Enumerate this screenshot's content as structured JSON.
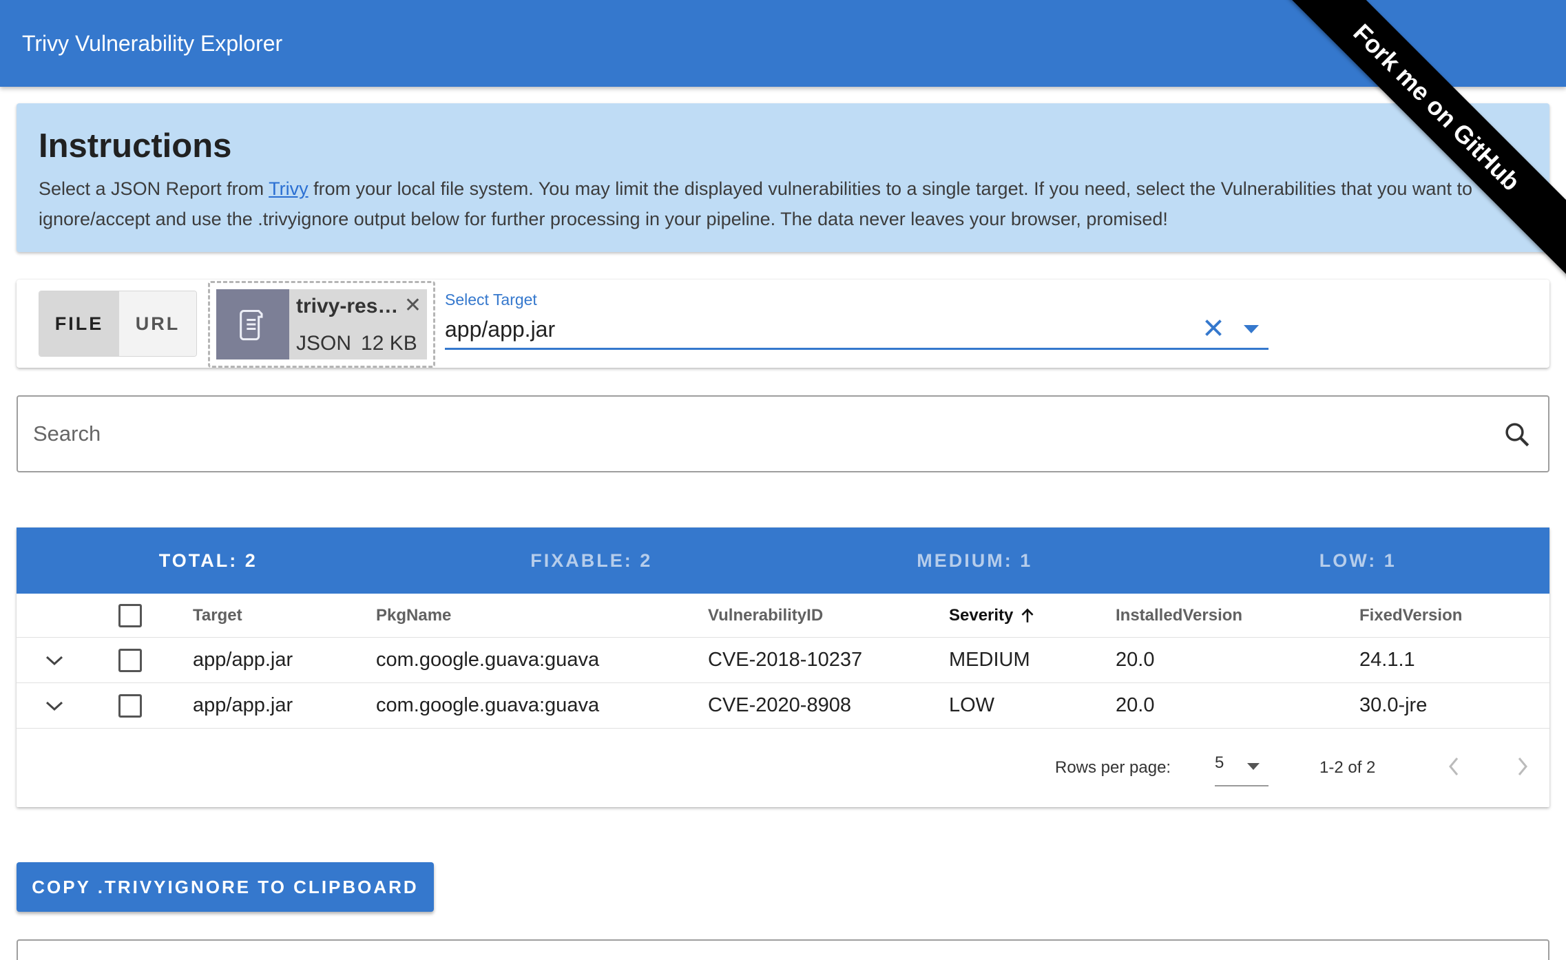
{
  "app": {
    "title": "Trivy Vulnerability Explorer"
  },
  "ribbon": {
    "label": "Fork me on GitHub"
  },
  "instructions": {
    "title": "Instructions",
    "text_before": "Select a JSON Report from ",
    "link": "Trivy",
    "text_after": " from your local file system. You may limit the displayed vulnerabilities to a single target. If you need, select the Vulnerabilities that you want to ignore/accept and use the .trivyignore output below for further processing in your pipeline. The data never leaves your browser, promised!"
  },
  "source_toggle": {
    "file": "FILE",
    "url": "URL",
    "selected": "FILE"
  },
  "file": {
    "name": "trivy-res…",
    "type": "JSON",
    "size": "12 KB"
  },
  "select_target": {
    "label": "Select Target",
    "value": "app/app.jar"
  },
  "search": {
    "placeholder": "Search",
    "value": ""
  },
  "stats": {
    "total": "TOTAL: 2",
    "fixable": "FIXABLE: 2",
    "medium": "MEDIUM: 1",
    "low": "LOW: 1"
  },
  "table": {
    "headers": {
      "target": "Target",
      "pkgname": "PkgName",
      "vulnid": "VulnerabilityID",
      "severity": "Severity",
      "installed": "InstalledVersion",
      "fixed": "FixedVersion"
    },
    "sort": {
      "column": "Severity",
      "direction": "ascending"
    },
    "rows": [
      {
        "target": "app/app.jar",
        "pkgname": "com.google.guava:guava",
        "vulnid": "CVE-2018-10237",
        "severity": "MEDIUM",
        "installed": "20.0",
        "fixed": "24.1.1"
      },
      {
        "target": "app/app.jar",
        "pkgname": "com.google.guava:guava",
        "vulnid": "CVE-2020-8908",
        "severity": "LOW",
        "installed": "20.0",
        "fixed": "30.0-jre"
      }
    ]
  },
  "pagination": {
    "rows_per_page_label": "Rows per page:",
    "rows_per_page": "5",
    "range": "1-2 of 2"
  },
  "actions": {
    "copy_label": "COPY .TRIVYIGNORE TO CLIPBOARD"
  },
  "colors": {
    "primary": "#3578cd",
    "instructions_bg": "#bfdcf5",
    "ribbon": "#000000"
  }
}
